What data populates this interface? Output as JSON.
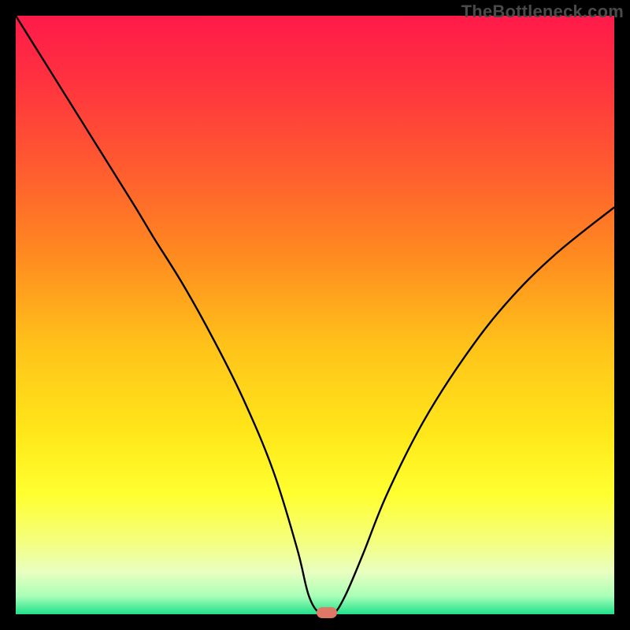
{
  "watermark": "TheBottleneck.com",
  "colors": {
    "frame": "#000000",
    "watermark_text": "#4a4a4a",
    "curve_stroke": "#000000",
    "marker_fill": "#e07868",
    "gradient_stops": [
      {
        "offset": 0.0,
        "color": "#ff1a4a"
      },
      {
        "offset": 0.1,
        "color": "#ff3040"
      },
      {
        "offset": 0.25,
        "color": "#ff5a30"
      },
      {
        "offset": 0.4,
        "color": "#ff8a20"
      },
      {
        "offset": 0.55,
        "color": "#ffc21a"
      },
      {
        "offset": 0.7,
        "color": "#ffe81a"
      },
      {
        "offset": 0.8,
        "color": "#ffff30"
      },
      {
        "offset": 0.88,
        "color": "#f4ff80"
      },
      {
        "offset": 0.93,
        "color": "#e8ffc0"
      },
      {
        "offset": 0.97,
        "color": "#a8ffb8"
      },
      {
        "offset": 1.0,
        "color": "#20e08a"
      }
    ]
  },
  "chart_data": {
    "type": "line",
    "title": "",
    "xlabel": "",
    "ylabel": "",
    "xlim": [
      0,
      100
    ],
    "ylim": [
      0,
      100
    ],
    "grid": false,
    "legend": false,
    "series": [
      {
        "name": "bottleneck-curve",
        "x": [
          0,
          5,
          10,
          15,
          20,
          23,
          28,
          33,
          38,
          43,
          47,
          49,
          51,
          53,
          55,
          58,
          62,
          68,
          75,
          82,
          90,
          100
        ],
        "y": [
          100,
          92,
          84,
          76,
          68,
          63,
          55,
          46,
          36,
          24,
          11,
          3,
          0,
          0,
          3,
          10,
          20,
          32,
          43,
          52,
          60,
          68
        ]
      }
    ],
    "marker": {
      "x": 52,
      "y": 0,
      "color": "#e07868"
    }
  }
}
